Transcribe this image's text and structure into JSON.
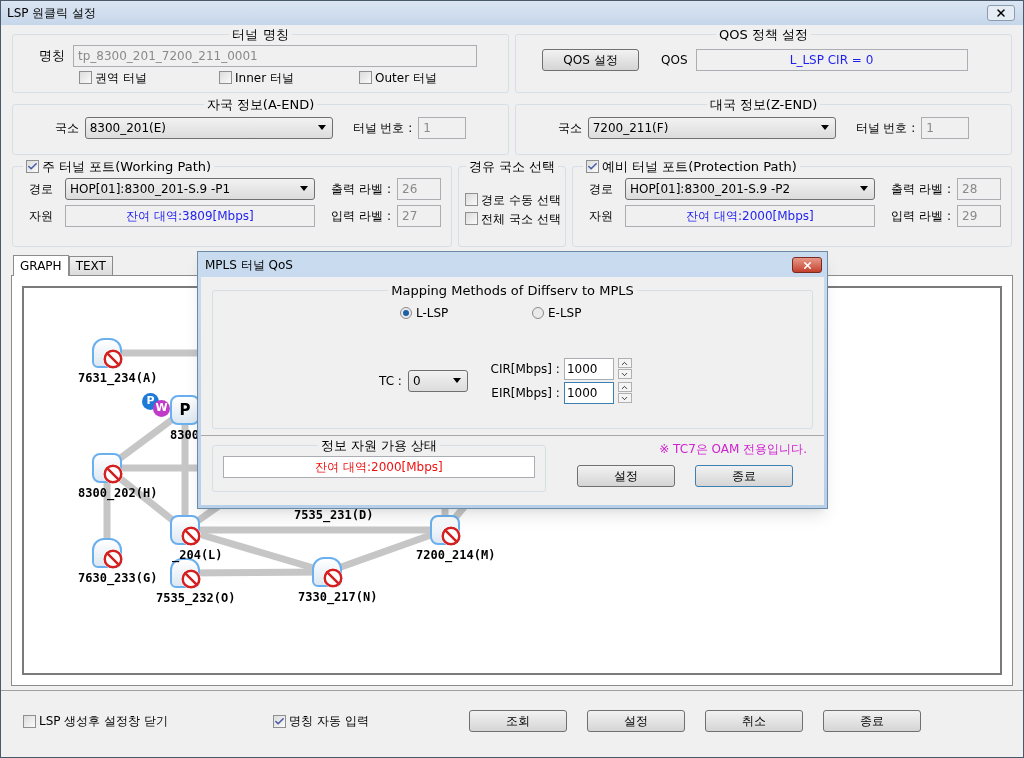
{
  "window": {
    "title": "LSP 원클릭 설정"
  },
  "tunnel_name": {
    "title": "터널 명칭",
    "label": "명칭",
    "value": "tp_8300_201_7200_211_0001",
    "options": [
      {
        "label": "권역 터널",
        "checked": false
      },
      {
        "label": "Inner 터널",
        "checked": false
      },
      {
        "label": "Outer 터널",
        "checked": false
      }
    ]
  },
  "qos_policy": {
    "title": "QOS 정책 설정",
    "button": "QOS 설정",
    "label": "QOS",
    "value": "L_LSP CIR = 0"
  },
  "a_end": {
    "title": "자국 정보(A-END)",
    "station_label": "국소",
    "station": "8300_201(E)",
    "tunnel_no_label": "터널 번호 :",
    "tunnel_no": "1"
  },
  "z_end": {
    "title": "대국 정보(Z-END)",
    "station_label": "국소",
    "station": "7200_211(F)",
    "tunnel_no_label": "터널 번호 :",
    "tunnel_no": "1"
  },
  "working_path": {
    "title": "주 터널 포트(Working Path)",
    "checked": true,
    "route_label": "경로",
    "route": "HOP[01]:8300_201-S.9 -P1",
    "resource_label": "자원",
    "resource": "잔여 대역:3809[Mbps]",
    "out_label_label": "출력 라벨 :",
    "out_label": "26",
    "in_label_label": "입력 라벨 :",
    "in_label": "27"
  },
  "via_station": {
    "title": "경유 국소 선택",
    "options": [
      {
        "label": "경로 수동 선택",
        "checked": false
      },
      {
        "label": "전체 국소 선택",
        "checked": false
      }
    ]
  },
  "protection_path": {
    "title": "예비 터널 포트(Protection Path)",
    "checked": true,
    "route_label": "경로",
    "route": "HOP[01]:8300_201-S.9 -P2",
    "resource_label": "자원",
    "resource": "잔여 대역:2000[Mbps]",
    "out_label_label": "출력 라벨 :",
    "out_label": "28",
    "in_label_label": "입력 라벨 :",
    "in_label": "29"
  },
  "tabs": [
    {
      "label": "GRAPH",
      "selected": true
    },
    {
      "label": "TEXT",
      "selected": false
    }
  ],
  "graph": {
    "nodes": [
      {
        "label": "7631_234(A)",
        "kind": "hexagon",
        "blocked": true
      },
      {
        "label": "8300",
        "kind": "rounded",
        "letter": "P",
        "blocked": false
      },
      {
        "label": "8300_202(H)",
        "kind": "rounded",
        "blocked": true
      },
      {
        "label": "_204(L)",
        "kind": "rounded",
        "blocked": true
      },
      {
        "label": "7630_233(G)",
        "kind": "hexagon",
        "blocked": true
      },
      {
        "label": "7535_232(O)",
        "kind": "hexagon",
        "blocked": true
      },
      {
        "label": "7330_217(N)",
        "kind": "hexagon",
        "blocked": true
      },
      {
        "label": "7200_214(M)",
        "kind": "rounded",
        "blocked": true
      },
      {
        "label": "7535_231(D)",
        "kind": "label_only"
      }
    ],
    "badges": [
      {
        "label": "P",
        "color": "#1d7ad8"
      },
      {
        "label": "W",
        "color": "#c03cc8"
      }
    ]
  },
  "dialog": {
    "title": "MPLS 터널 QoS",
    "mapping_title": "Mapping Methods of Diffserv to MPLS",
    "methods": [
      {
        "label": "L-LSP",
        "selected": true
      },
      {
        "label": "E-LSP",
        "selected": false
      }
    ],
    "tc_label": "TC :",
    "tc": "0",
    "cir_label": "CIR[Mbps] :",
    "cir": "1000",
    "eir_label": "EIR[Mbps] :",
    "eir": "1000",
    "status_title": "정보 자원 가용 상태",
    "status": "잔여 대역:2000[Mbps]",
    "note": "※ TC7은 OAM 전용입니다.",
    "buttons": [
      "설정",
      "종료"
    ]
  },
  "footer": {
    "options": [
      {
        "label": "LSP 생성후 설정창 닫기",
        "checked": false
      },
      {
        "label": "명칭 자동 입력",
        "checked": true
      }
    ],
    "buttons": [
      "조회",
      "설정",
      "취소",
      "종료"
    ]
  }
}
